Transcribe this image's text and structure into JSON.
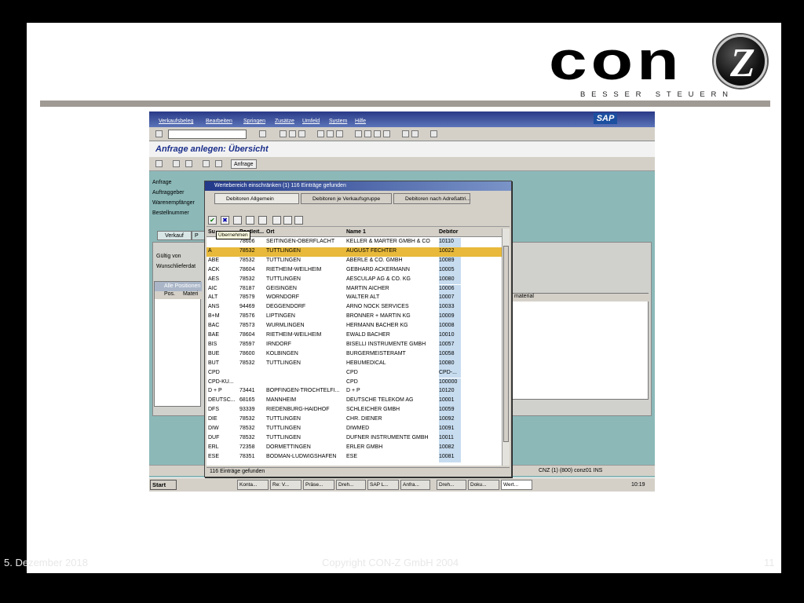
{
  "slide": {
    "logo_text": "con",
    "logo_z": "Z",
    "logo_tagline": "BESSER STEUERN",
    "footer_date": "5. Dezember 2018",
    "footer_copyright": "Copyright CON-Z GmbH 2004",
    "footer_page": "11"
  },
  "sap": {
    "menu": [
      "Verkaufsbeleg",
      "Bearbeiten",
      "Springen",
      "Zusätze",
      "Umfeld",
      "System",
      "Hilfe"
    ],
    "brand": "SAP",
    "title": "Anfrage anlegen: Übersicht",
    "anfrage_button": "Anfrage",
    "fields": [
      "Anfrage",
      "Auftraggeber",
      "Warenempfänger",
      "Bestellnummer"
    ],
    "tabs": [
      "Verkauf",
      "P"
    ],
    "labels": {
      "gueltig_von": "Gültig von",
      "wunschlieferdat": "Wunschlieferdat",
      "alle_positionen": "Alle Positionen",
      "pos": "Pos.",
      "material_short": "Materi",
      "material_right": "material"
    },
    "status_bar": "CNZ (1) (800)   conz01   INS",
    "taskbar": {
      "start": "Start",
      "items": [
        "Konta...",
        "Re: V...",
        "Präse...",
        "Dreh...",
        "SAP L...",
        "Anfra...",
        "Dreh...",
        "Doku...",
        "Wert..."
      ],
      "clock": "10:19"
    }
  },
  "dialog": {
    "title": "Wertebereich einschränken (1)  116 Einträge gefunden",
    "tabs": [
      "Debitoren Allgemein",
      "Debitoren je Verkaufsgruppe",
      "Debitoren nach Adreßattri..."
    ],
    "tooltip": "Übernehmen",
    "columns": [
      "Su",
      "Postleit...",
      "Ort",
      "Name 1",
      "Debitor"
    ],
    "rows": [
      [
        "",
        "78606",
        "SEITINGEN-OBERFLACHT",
        "KELLER & MARTER GMBH & CO",
        "10110"
      ],
      [
        "A",
        "78532",
        "TUTTLINGEN",
        "AUGUST FECHTER",
        "10022"
      ],
      [
        "ABE",
        "78532",
        "TUTTLINGEN",
        "ABERLE & CO. GMBH",
        "10089"
      ],
      [
        "ACK",
        "78604",
        "RIETHEIM-WEILHEIM",
        "GEBHARD ACKERMANN",
        "10005"
      ],
      [
        "AES",
        "78532",
        "TUTTLINGEN",
        "AESCULAP AG & CO. KG",
        "10080"
      ],
      [
        "AIC",
        "78187",
        "GEISINGEN",
        "MARTIN AICHER",
        "10006"
      ],
      [
        "ALT",
        "78579",
        "WORNDORF",
        "WALTER ALT",
        "10007"
      ],
      [
        "ANS",
        "94469",
        "DEGGENDORF",
        "ARNO NOCK SERVICES",
        "10033"
      ],
      [
        "B+M",
        "78576",
        "LIPTINGEN",
        "BRONNER + MARTIN KG",
        "10009"
      ],
      [
        "BAC",
        "78573",
        "WURMLINGEN",
        "HERMANN BACHER KG",
        "10008"
      ],
      [
        "BAE",
        "78604",
        "RIETHEIM-WEILHEIM",
        "EWALD BACHER",
        "10010"
      ],
      [
        "BIS",
        "78597",
        "IRNDORF",
        "BISELLI INSTRUMENTE GMBH",
        "10057"
      ],
      [
        "BUE",
        "78600",
        "KOLBINGEN",
        "BÜRGERMEISTERAMT",
        "10058"
      ],
      [
        "BUT",
        "78532",
        "TUTTLINGEN",
        "HEBUMEDICAL",
        "10080"
      ],
      [
        "CPD",
        "",
        "",
        "CPD",
        "CPD-..."
      ],
      [
        "CPD-KU...",
        "",
        "",
        "CPD",
        "100000"
      ],
      [
        "D + P",
        "73441",
        "BOPFINGEN-TROCHTELFI...",
        "D + P",
        "10120"
      ],
      [
        "DEUTSC...",
        "68165",
        "MANNHEIM",
        "DEUTSCHE TELEKOM AG",
        "10001"
      ],
      [
        "DFS",
        "93339",
        "RIEDENBURG-HAIDHOF",
        "SCHLEICHER GMBH",
        "10059"
      ],
      [
        "DIE",
        "78532",
        "TUTTLINGEN",
        "CHR. DIENER",
        "10092"
      ],
      [
        "DIW",
        "78532",
        "TUTTLINGEN",
        "DIWMED",
        "10091"
      ],
      [
        "DUF",
        "78532",
        "TUTTLINGEN",
        "DUFNER INSTRUMENTE GMBH",
        "10011"
      ],
      [
        "ERL",
        "72358",
        "DORMETTINGEN",
        "ERLER GMBH",
        "10082"
      ],
      [
        "ESE",
        "78351",
        "BODMAN-LUDWIGSHAFEN",
        "ESE",
        "10081"
      ]
    ],
    "status": "116 Einträge gefunden"
  },
  "colors": {
    "selected_row": "#e8b93a",
    "debitor_col": "#c7dcef",
    "sap_bg": "#8cb8b8"
  }
}
